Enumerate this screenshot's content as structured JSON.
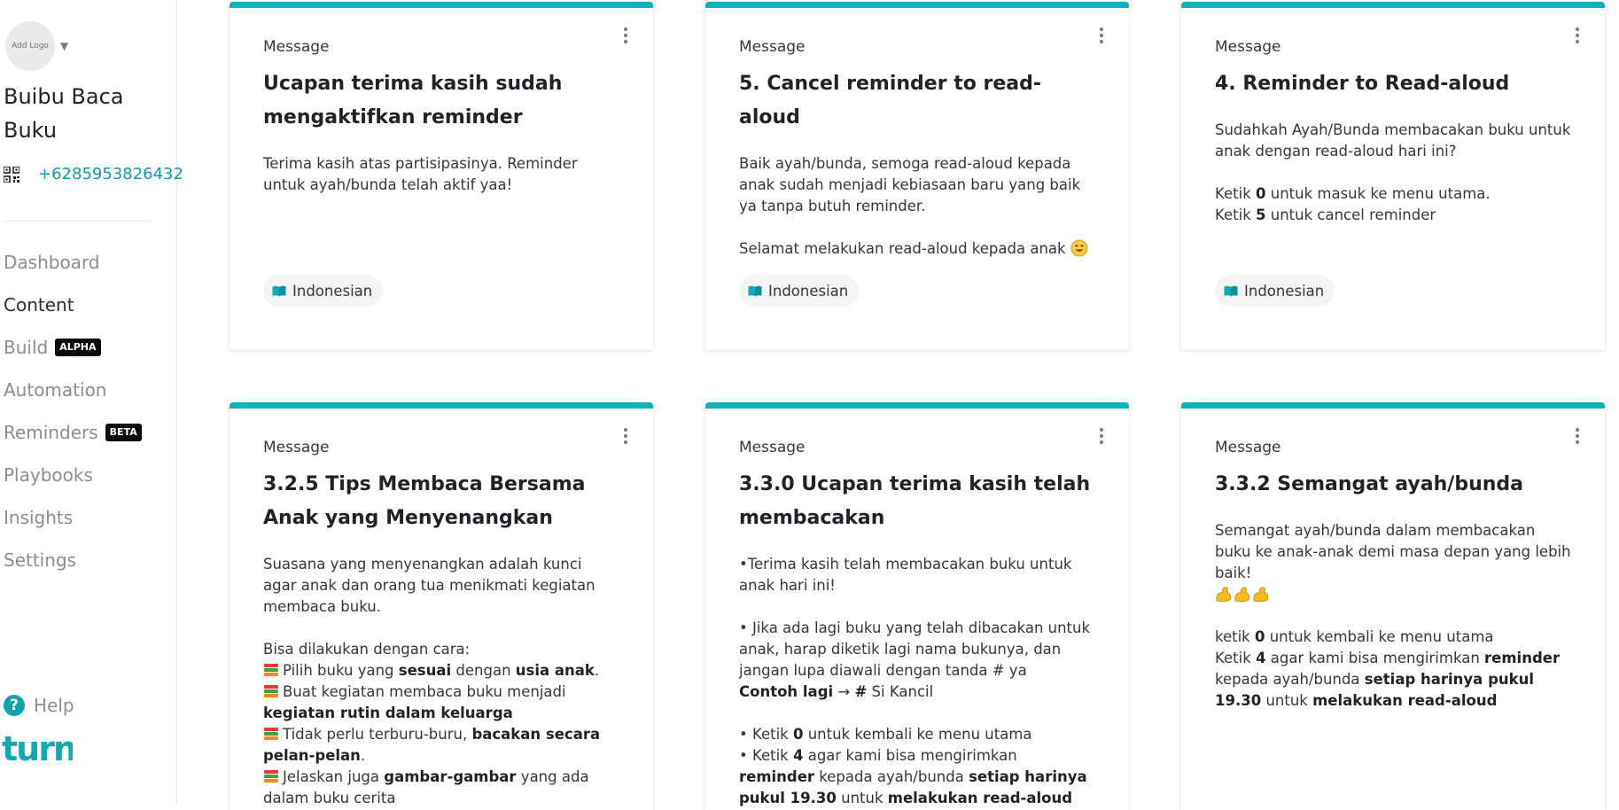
{
  "sidebar": {
    "logo_placeholder": "Add Logo",
    "org_name": "Buibu Baca Buku",
    "phone": "+6285953826432",
    "nav": [
      {
        "label": "Dashboard",
        "active": false,
        "badge": ""
      },
      {
        "label": "Content",
        "active": true,
        "badge": ""
      },
      {
        "label": "Build",
        "active": false,
        "badge": "ALPHA"
      },
      {
        "label": "Automation",
        "active": false,
        "badge": ""
      },
      {
        "label": "Reminders",
        "active": false,
        "badge": "BETA"
      },
      {
        "label": "Playbooks",
        "active": false,
        "badge": ""
      },
      {
        "label": "Insights",
        "active": false,
        "badge": ""
      },
      {
        "label": "Settings",
        "active": false,
        "badge": ""
      }
    ],
    "help_label": "Help",
    "brand": "turn"
  },
  "colors": {
    "accent": "#13afba",
    "link": "#0f9aa3",
    "badge_bg": "#0a0a0a"
  },
  "cards": [
    {
      "type": "Message",
      "title": "Ucapan terima kasih sudah mengaktifkan reminder",
      "body": [
        "Terima kasih atas partisipasinya. Reminder untuk ayah/bunda telah aktif yaa!"
      ],
      "language": "Indonesian"
    },
    {
      "type": "Message",
      "title": "5. Cancel reminder to read-aloud",
      "body": [
        "Baik ayah/bunda, semoga read-aloud kepada anak sudah menjadi kebiasaan baru yang baik ya tanpa butuh reminder.",
        "",
        "Selamat melakukan read-aloud kepada anak"
      ],
      "language": "Indonesian"
    },
    {
      "type": "Message",
      "title": "4. Reminder to Read-aloud",
      "body": [
        "Sudahkah Ayah/Bunda membacakan buku untuk anak dengan read-aloud hari ini?",
        "",
        "Ketik ",
        "0",
        " untuk masuk ke menu utama.",
        "Ketik ",
        "5",
        " untuk cancel reminder"
      ],
      "language": "Indonesian"
    },
    {
      "type": "Message",
      "title": "3.2.5 Tips Membaca Bersama Anak yang Menyenangkan",
      "body": [
        "Suasana yang menyenangkan adalah kunci agar anak dan orang tua menikmati kegiatan membaca buku.",
        "Bisa dilakukan dengan cara:",
        "Pilih buku yang ",
        "sesuai",
        " dengan ",
        "usia anak",
        ".",
        "Buat kegiatan membaca buku menjadi ",
        "kegiatan rutin dalam keluarga",
        "Tidak perlu terburu-buru, ",
        "bacakan secara pelan-pelan",
        ".",
        "Jelaskan juga ",
        "gambar-gambar",
        " yang ada dalam buku cerita"
      ],
      "language": "Indonesian"
    },
    {
      "type": "Message",
      "title": "3.3.0 Ucapan terima kasih telah membacakan",
      "body": [
        "•Terima kasih telah membacakan buku untuk anak hari ini!",
        "• Jika ada lagi buku yang telah dibacakan untuk anak, harap diketik lagi nama bukunya, dan jangan lupa diawali dengan tanda # ya",
        "Contoh lagi",
        " → ",
        "#",
        " Si Kancil",
        "• Ketik ",
        "0",
        " untuk kembali ke menu utama",
        "• Ketik ",
        "4",
        " agar kami bisa mengirimkan ",
        "reminder",
        " kepada ayah/bunda ",
        "setiap harinya pukul 19.30",
        " untuk ",
        "melakukan read-aloud"
      ],
      "language": "Indonesian"
    },
    {
      "type": "Message",
      "title": "3.3.2 Semangat ayah/bunda",
      "body": [
        "Semangat ayah/bunda dalam membacakan buku ke anak-anak demi masa depan yang lebih baik!",
        "ketik ",
        "0",
        " untuk kembali ke menu utama",
        "Ketik ",
        "4",
        " agar kami bisa mengirimkan ",
        "reminder",
        " kepada ayah/bunda ",
        "setiap harinya pukul 19.30",
        " untuk ",
        "melakukan read-aloud"
      ],
      "language": "Indonesian"
    }
  ],
  "icons": {
    "card_menu": "vertical-dots-icon",
    "language": "book-icon",
    "help": "question-circle-icon",
    "qr": "qr-code-icon"
  }
}
